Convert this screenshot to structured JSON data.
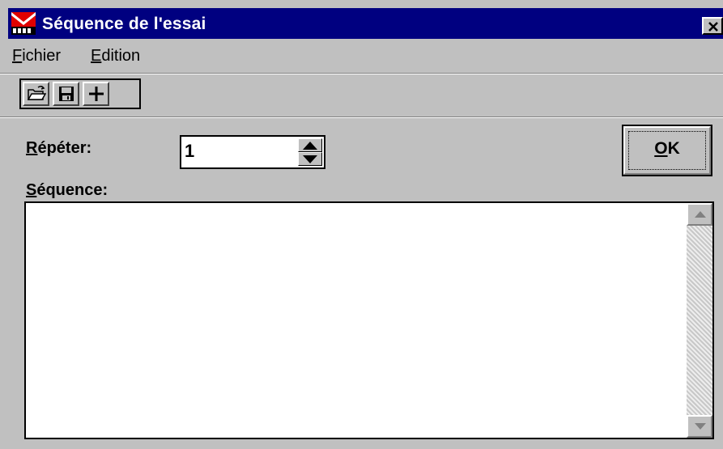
{
  "window": {
    "title": "Séquence de l'essai",
    "app_icon": "flag-app-icon",
    "close_icon": "close-icon"
  },
  "menu": {
    "file": {
      "mnemonic": "F",
      "rest": "ichier"
    },
    "edit": {
      "mnemonic": "E",
      "rest": "dition"
    }
  },
  "toolbar": {
    "open_icon": "folder-open-icon",
    "save_icon": "floppy-disk-icon",
    "add_icon": "plus-icon"
  },
  "form": {
    "repeat_label": {
      "mnemonic": "R",
      "rest": "épéter:"
    },
    "repeat_value": "1",
    "sequence_label": {
      "mnemonic": "S",
      "rest": "équence:"
    },
    "sequence_text": ""
  },
  "ok_button": {
    "mnemonic": "O",
    "rest": "K"
  },
  "colors": {
    "titlebar": "#000080",
    "face": "#c0c0c0",
    "icon_red": "#e00000"
  }
}
